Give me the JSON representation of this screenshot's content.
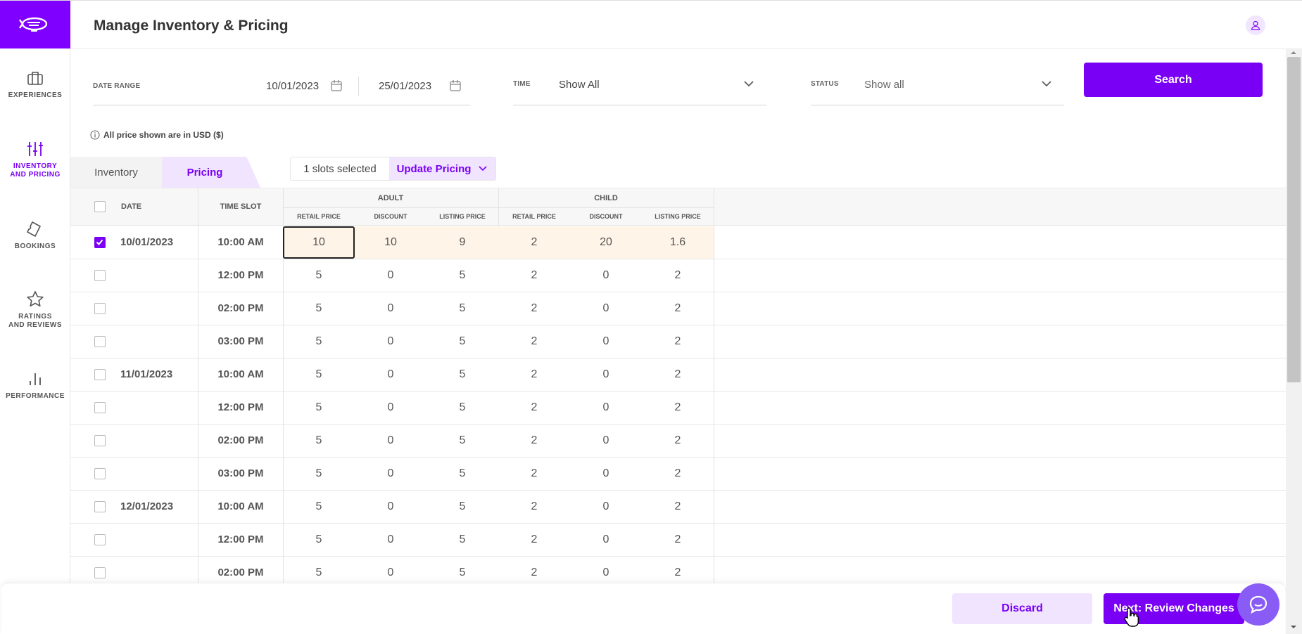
{
  "sidebar": {
    "items": [
      {
        "label_line1": "EXPERIENCES",
        "label_line2": ""
      },
      {
        "label_line1": "INVENTORY",
        "label_line2": "AND PRICING"
      },
      {
        "label_line1": "BOOKINGS",
        "label_line2": ""
      },
      {
        "label_line1": "RATINGS",
        "label_line2": "AND REVIEWS"
      },
      {
        "label_line1": "PERFORMANCE",
        "label_line2": ""
      }
    ]
  },
  "header": {
    "title": "Manage Inventory & Pricing"
  },
  "filters": {
    "date_range_label": "DATE RANGE",
    "date_from": "10/01/2023",
    "date_to": "25/01/2023",
    "time_label": "TIME",
    "time_value": "Show All",
    "status_label": "STATUS",
    "status_value": "Show all",
    "search_label": "Search"
  },
  "note": "All price shown are in USD ($)",
  "tabs": {
    "inventory": "Inventory",
    "pricing": "Pricing"
  },
  "selection": {
    "count_text": "1 slots selected",
    "update_label": "Update Pricing"
  },
  "table": {
    "headers": {
      "date": "DATE",
      "time_slot": "TIME SLOT",
      "adult": "ADULT",
      "child": "CHILD",
      "retail_price": "RETAIL PRICE",
      "discount": "DISCOUNT",
      "listing_price": "LISTING PRICE"
    },
    "rows": [
      {
        "date": "10/01/2023",
        "time": "10:00 AM",
        "checked": true,
        "values": [
          "10",
          "10",
          "9",
          "2",
          "20",
          "1.6"
        ]
      },
      {
        "date": "",
        "time": "12:00 PM",
        "checked": false,
        "values": [
          "5",
          "0",
          "5",
          "2",
          "0",
          "2"
        ]
      },
      {
        "date": "",
        "time": "02:00 PM",
        "checked": false,
        "values": [
          "5",
          "0",
          "5",
          "2",
          "0",
          "2"
        ]
      },
      {
        "date": "",
        "time": "03:00 PM",
        "checked": false,
        "values": [
          "5",
          "0",
          "5",
          "2",
          "0",
          "2"
        ]
      },
      {
        "date": "11/01/2023",
        "time": "10:00 AM",
        "checked": false,
        "values": [
          "5",
          "0",
          "5",
          "2",
          "0",
          "2"
        ]
      },
      {
        "date": "",
        "time": "12:00 PM",
        "checked": false,
        "values": [
          "5",
          "0",
          "5",
          "2",
          "0",
          "2"
        ]
      },
      {
        "date": "",
        "time": "02:00 PM",
        "checked": false,
        "values": [
          "5",
          "0",
          "5",
          "2",
          "0",
          "2"
        ]
      },
      {
        "date": "",
        "time": "03:00 PM",
        "checked": false,
        "values": [
          "5",
          "0",
          "5",
          "2",
          "0",
          "2"
        ]
      },
      {
        "date": "12/01/2023",
        "time": "10:00 AM",
        "checked": false,
        "values": [
          "5",
          "0",
          "5",
          "2",
          "0",
          "2"
        ]
      },
      {
        "date": "",
        "time": "12:00 PM",
        "checked": false,
        "values": [
          "5",
          "0",
          "5",
          "2",
          "0",
          "2"
        ]
      },
      {
        "date": "",
        "time": "02:00 PM",
        "checked": false,
        "values": [
          "5",
          "0",
          "5",
          "2",
          "0",
          "2"
        ]
      }
    ]
  },
  "footer": {
    "discard_label": "Discard",
    "next_label": "Next: Review Changes"
  },
  "colors": {
    "accent": "#7a00f5",
    "accent_light": "#f0e4ff",
    "edited_cell": "#fff4e8"
  }
}
